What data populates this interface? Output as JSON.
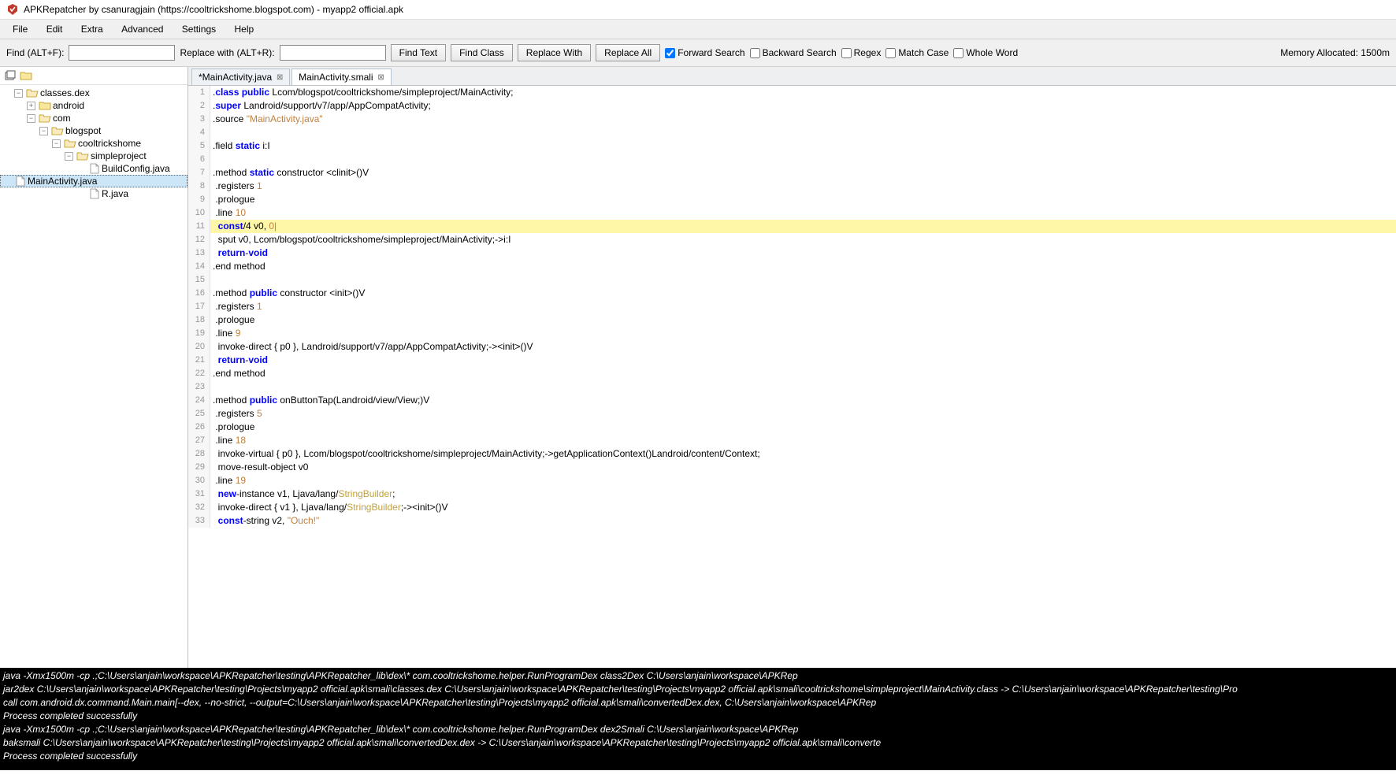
{
  "title": "APKRepatcher by csanuragjain (https://cooltrickshome.blogspot.com) - myapp2 official.apk",
  "menubar": {
    "items": [
      "File",
      "Edit",
      "Extra",
      "Advanced",
      "Settings",
      "Help"
    ]
  },
  "toolbar": {
    "find_label": "Find (ALT+F):",
    "replace_label": "Replace with (ALT+R):",
    "buttons": {
      "find_text": "Find Text",
      "find_class": "Find Class",
      "replace_with": "Replace With",
      "replace_all": "Replace All"
    },
    "chk": {
      "forward": "Forward Search",
      "backward": "Backward Search",
      "regex": "Regex",
      "matchcase": "Match Case",
      "wholeword": "Whole Word"
    },
    "memory": "Memory Allocated: 1500m"
  },
  "tree": {
    "root": "classes.dex",
    "android": "android",
    "com": "com",
    "blogspot": "blogspot",
    "cooltrickshome": "cooltrickshome",
    "simpleproject": "simpleproject",
    "buildconfig": "BuildConfig.java",
    "mainactivity": "MainActivity.java",
    "r": "R.java"
  },
  "tabs": {
    "main": "*MainActivity.java",
    "smali": "MainActivity.smali"
  },
  "code": {
    "l1p1": ".",
    "l1k1": "class",
    "l1s1": " ",
    "l1k2": "public",
    "l1p2": " Lcom/blogspot/cooltrickshome/simpleproject/MainActivity;",
    "l2p1": ".",
    "l2k1": "super",
    "l2p2": " Landroid/support/v7/app/AppCompatActivity;",
    "l3p1": ".source ",
    "l3s1": "\"MainActivity.java\"",
    "l4": "",
    "l5p1": ".field ",
    "l5k1": "static",
    "l5p2": " i:I",
    "l6": "",
    "l7p1": ".method ",
    "l7k1": "static",
    "l7p2": " constructor <clinit>()V",
    "l8p1": " .registers ",
    "l8n1": "1",
    "l9p1": " .prologue",
    "l10p1": " .line ",
    "l10n1": "10",
    "l11p1": "  ",
    "l11k1": "const",
    "l11p2": "/4 v0, ",
    "l11n1": "0|",
    "l12p1": "  sput v0, Lcom/blogspot/cooltrickshome/simpleproject/MainActivity;->i:I",
    "l13p1": "  ",
    "l13k1": "return",
    "l13p2": "-",
    "l13k2": "void",
    "l14p1": ".end method",
    "l15": "",
    "l16p1": ".method ",
    "l16k1": "public",
    "l16p2": " constructor <init>()V",
    "l17p1": " .registers ",
    "l17n1": "1",
    "l18p1": " .prologue",
    "l19p1": " .line ",
    "l19n1": "9",
    "l20p1": "  invoke-direct { p0 }, Landroid/support/v7/app/AppCompatActivity;-><init>()V",
    "l21p1": "  ",
    "l21k1": "return",
    "l21p2": "-",
    "l21k2": "void",
    "l22p1": ".end method",
    "l23": "",
    "l24p1": ".method ",
    "l24k1": "public",
    "l24p2": " onButtonTap(Landroid/view/View;)V",
    "l25p1": " .registers ",
    "l25n1": "5",
    "l26p1": " .prologue",
    "l27p1": " .line ",
    "l27n1": "18",
    "l28p1": "  invoke-virtual { p0 }, Lcom/blogspot/cooltrickshome/simpleproject/MainActivity;->getApplicationContext()Landroid/content/Context;",
    "l29p1": "  move-result-object v0",
    "l30p1": " .line ",
    "l30n1": "19",
    "l31p1": "  ",
    "l31k1": "new",
    "l31p2": "-instance v1, Ljava/lang/",
    "l31y1": "StringBuilder",
    "l31p3": ";",
    "l32p1": "  invoke-direct { v1 }, Ljava/lang/",
    "l32y1": "StringBuilder",
    "l32p2": ";-><init>()V",
    "l33p1": "  ",
    "l33k1": "const",
    "l33p2": "-string v2, ",
    "l33s1": "\"Ouch!\""
  },
  "lineno": {
    "1": "1",
    "2": "2",
    "3": "3",
    "4": "4",
    "5": "5",
    "6": "6",
    "7": "7",
    "8": "8",
    "9": "9",
    "10": "10",
    "11": "11",
    "12": "12",
    "13": "13",
    "14": "14",
    "15": "15",
    "16": "16",
    "17": "17",
    "18": "18",
    "19": "19",
    "20": "20",
    "21": "21",
    "22": "22",
    "23": "23",
    "24": "24",
    "25": "25",
    "26": "26",
    "27": "27",
    "28": "28",
    "29": "29",
    "30": "30",
    "31": "31",
    "32": "32",
    "33": "33"
  },
  "console": {
    "l1": "java -Xmx1500m -cp .;C:\\Users\\anjain\\workspace\\APKRepatcher\\testing\\APKRepatcher_lib\\dex\\* com.cooltrickshome.helper.RunProgramDex class2Dex C:\\Users\\anjain\\workspace\\APKRep",
    "l2": "jar2dex C:\\Users\\anjain\\workspace\\APKRepatcher\\testing\\Projects\\myapp2 official.apk\\smali\\classes.dex C:\\Users\\anjain\\workspace\\APKRepatcher\\testing\\Projects\\myapp2 official.apk\\smali\\cooltrickshome\\simpleproject\\MainActivity.class -> C:\\Users\\anjain\\workspace\\APKRepatcher\\testing\\Pro",
    "l3": "call com.android.dx.command.Main.main[--dex, --no-strict, --output=C:\\Users\\anjain\\workspace\\APKRepatcher\\testing\\Projects\\myapp2 official.apk\\smali\\convertedDex.dex, C:\\Users\\anjain\\workspace\\APKRep",
    "l4": "Process completed successfully",
    "l5": "java -Xmx1500m -cp .;C:\\Users\\anjain\\workspace\\APKRepatcher\\testing\\APKRepatcher_lib\\dex\\* com.cooltrickshome.helper.RunProgramDex dex2Smali C:\\Users\\anjain\\workspace\\APKRep",
    "l6": "baksmali C:\\Users\\anjain\\workspace\\APKRepatcher\\testing\\Projects\\myapp2 official.apk\\smali\\convertedDex.dex -> C:\\Users\\anjain\\workspace\\APKRepatcher\\testing\\Projects\\myapp2 official.apk\\smali\\converte",
    "l7": "Process completed successfully"
  }
}
